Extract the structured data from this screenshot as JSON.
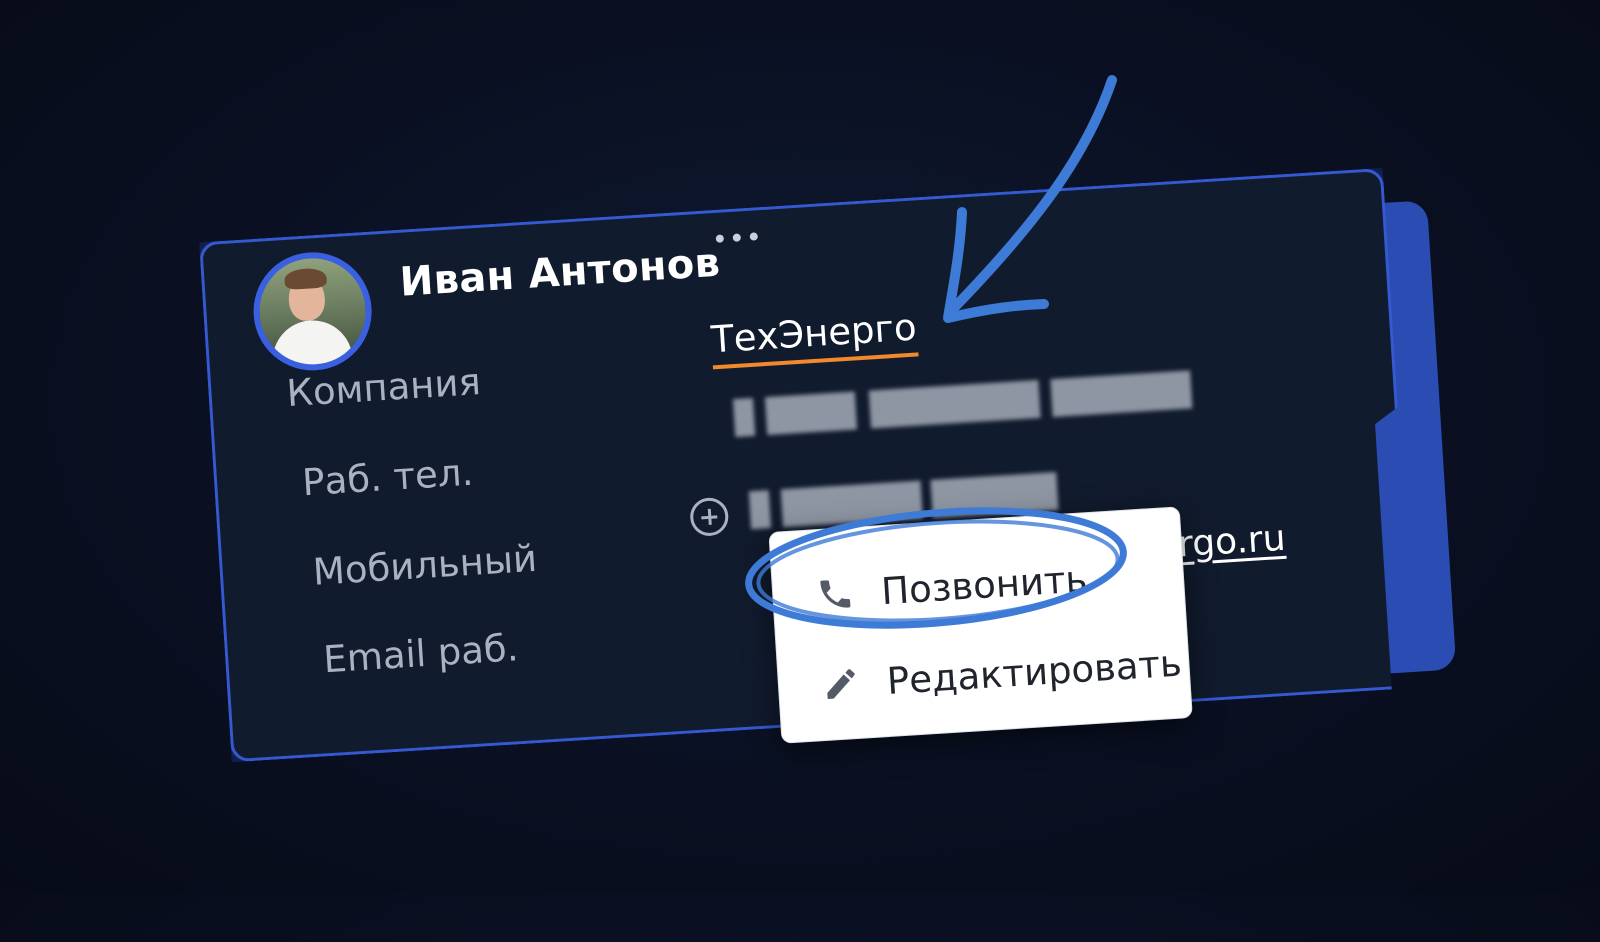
{
  "contact": {
    "name": "Иван Антонов",
    "fields": {
      "company_label": "Компания",
      "work_phone_label": "Раб. тел.",
      "mobile_label": "Мобильный",
      "email_label": "Email раб."
    },
    "company_value": "ТехЭнерго",
    "email_value_visible": "ergo.ru"
  },
  "context_menu": {
    "call_label": "Позвонить",
    "edit_label": "Редактировать"
  },
  "colors": {
    "accent_blue": "#3559d0",
    "company_underline": "#f08a2c",
    "annotation": "#3d7bd6"
  }
}
